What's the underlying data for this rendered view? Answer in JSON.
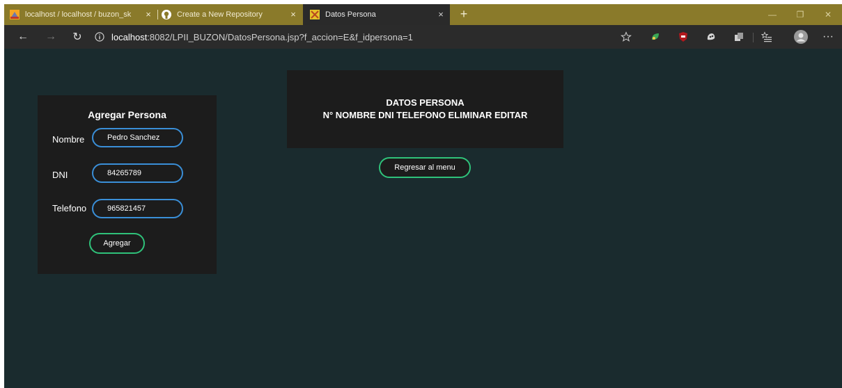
{
  "browser": {
    "tabs": [
      {
        "title": "localhost / localhost / buzon_sk",
        "close": "×"
      },
      {
        "title": "Create a New Repository",
        "close": "×"
      },
      {
        "title": "Datos Persona",
        "close": "×"
      }
    ],
    "new_tab": "+",
    "window_controls": {
      "minimize": "—",
      "restore": "❐",
      "close": "✕"
    },
    "url": {
      "host": "localhost",
      "rest": ":8082/LPII_BUZON/DatosPersona.jsp?f_accion=E&f_idpersona=1"
    },
    "nav": {
      "back": "←",
      "forward": "→",
      "refresh": "↻"
    },
    "more": "···"
  },
  "form": {
    "title": "Agregar Persona",
    "fields": [
      {
        "label": "Nombre",
        "value": "Pedro Sanchez"
      },
      {
        "label": "DNI",
        "value": "84265789"
      },
      {
        "label": "Telefono",
        "value": "965821457"
      }
    ],
    "submit": "Agregar"
  },
  "table": {
    "title": "DATOS PERSONA",
    "header": "N° NOMBRE DNI TELEFONO ELIMINAR EDITAR"
  },
  "back_button": "Regresar al menu",
  "colors": {
    "page_bg": "#1a2b2e",
    "panel_bg": "#1c1c1c",
    "input_border": "#3a8fd8",
    "button_border": "#2fc27a",
    "tabstrip": "#8a7a2a"
  }
}
